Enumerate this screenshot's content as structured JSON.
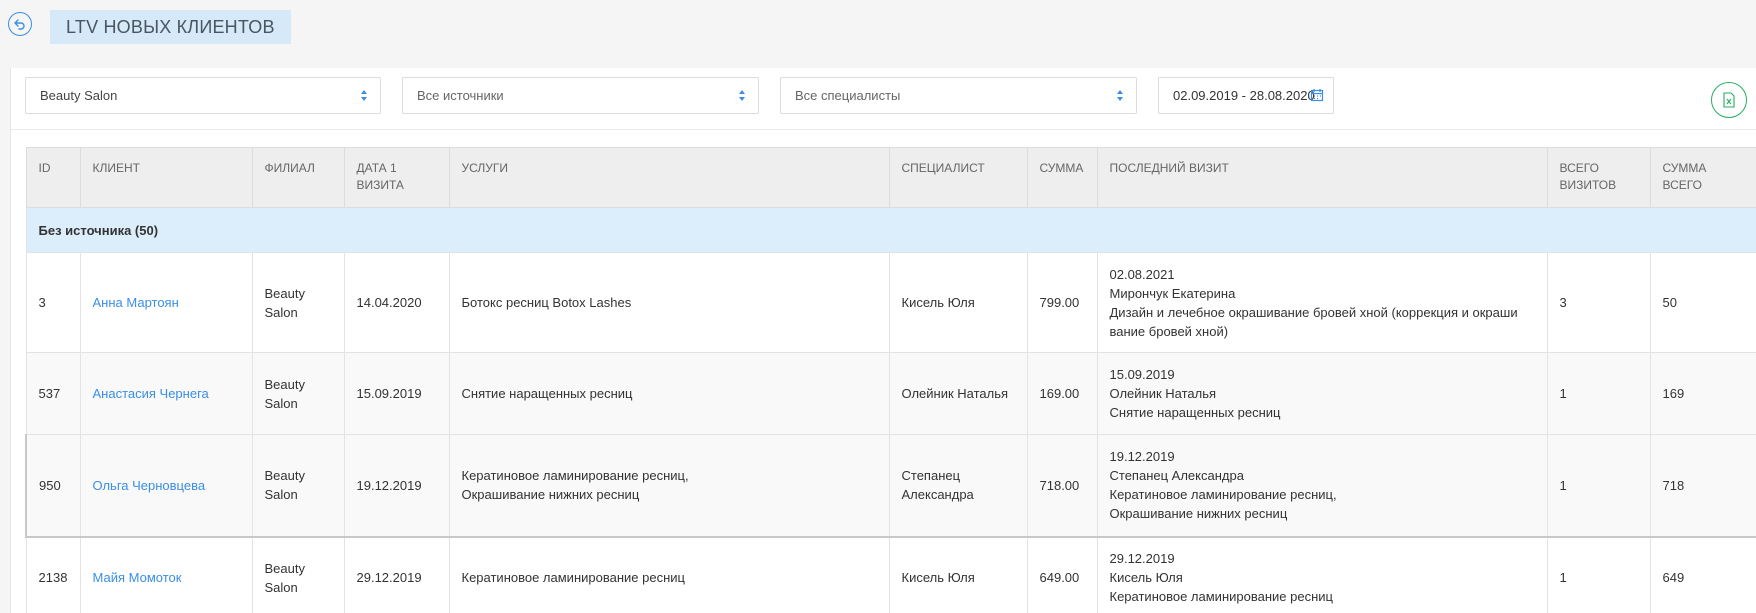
{
  "header": {
    "title": "LTV НОВЫХ КЛИЕНТОВ",
    "back_icon": "back-arrow-icon"
  },
  "filters": {
    "branch": "Beauty Salon",
    "source": "Все источники",
    "specialist": "Все специалисты",
    "date_range": "02.09.2019 - 28.08.2020",
    "export_icon": "excel-export-icon"
  },
  "table": {
    "columns": [
      "ID",
      "КЛИЕНТ",
      "ФИЛИАЛ",
      "ДАТА 1 ВИЗИТА",
      "УСЛУГИ",
      "СПЕЦИАЛИСТ",
      "СУММА",
      "ПОСЛЕДНИЙ ВИЗИТ",
      "ВСЕГО ВИЗИТОВ",
      "СУММА ВСЕГО"
    ],
    "group_label": "Без источника (50)",
    "rows": [
      {
        "id": "3",
        "client": "Анна Мартоян",
        "branch": "Beauty Salon",
        "first_visit": "14.04.2020",
        "services": [
          "Ботокс ресниц Botox Lashes"
        ],
        "specialist": "Кисель Юля",
        "sum": "799.00",
        "last_visit": [
          "02.08.2021",
          "Мирончук Екатерина",
          "Дизайн и лечебное окрашивание бровей хной (коррекция и окраши",
          "вание бровей хной)"
        ],
        "total_visits": "3",
        "total_sum": "50"
      },
      {
        "id": "537",
        "client": "Анастасия Чернега",
        "branch": "Beauty Salon",
        "first_visit": "15.09.2019",
        "services": [
          "Снятие наращенных ресниц"
        ],
        "specialist": "Олейник Наталья",
        "sum": "169.00",
        "last_visit": [
          "15.09.2019",
          "Олейник Наталья",
          "Снятие наращенных ресниц"
        ],
        "total_visits": "1",
        "total_sum": "169"
      },
      {
        "id": "950",
        "client": "Ольга Черновцева",
        "branch": "Beauty Salon",
        "first_visit": "19.12.2019",
        "services": [
          "Кератиновое ламинирование ресниц,",
          "Окрашивание нижних ресниц"
        ],
        "specialist": "Степанец Александра",
        "sum": "718.00",
        "last_visit": [
          "19.12.2019",
          "Степанец Александра",
          "Кератиновое ламинирование ресниц,",
          "Окрашивание нижних ресниц"
        ],
        "total_visits": "1",
        "total_sum": "718"
      },
      {
        "id": "2138",
        "client": "Майя Момоток",
        "branch": "Beauty Salon",
        "first_visit": "29.12.2019",
        "services": [
          "Кератиновое ламинирование ресниц"
        ],
        "specialist": "Кисель Юля",
        "sum": "649.00",
        "last_visit": [
          "29.12.2019",
          "Кисель Юля",
          "Кератиновое ламинирование ресниц"
        ],
        "total_visits": "1",
        "total_sum": "649"
      }
    ]
  }
}
